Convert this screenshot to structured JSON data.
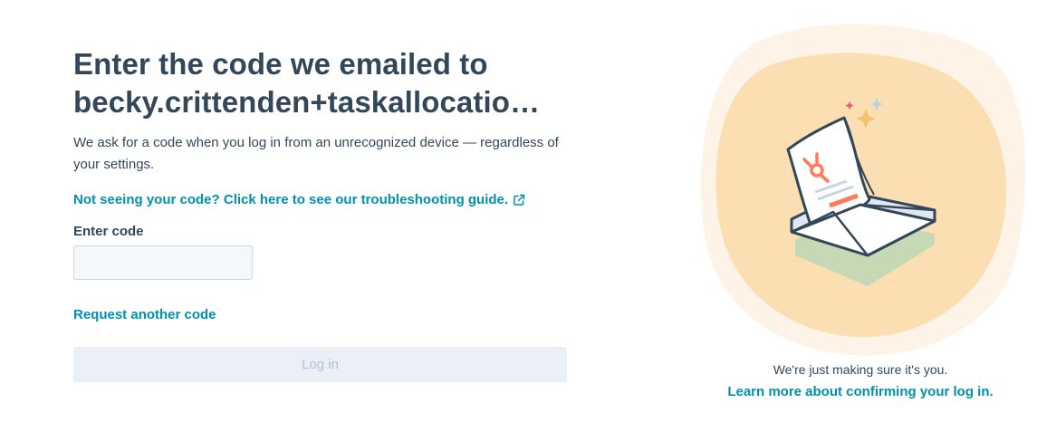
{
  "heading": {
    "line1": "Enter the code we emailed to",
    "line2": "becky.crittenden+taskallocatio…"
  },
  "description": "We ask for a code when you log in from an unrecognized device — regardless of your settings.",
  "troubleshooting_link": {
    "label": "Not seeing your code? Click here to see our troubleshooting guide.",
    "icon": "external-link-icon"
  },
  "code_field": {
    "label": "Enter code",
    "value": "",
    "placeholder": ""
  },
  "request_link": {
    "label": "Request another code"
  },
  "login_button": {
    "label": "Log in",
    "disabled": true
  },
  "side_panel": {
    "caption": "We're just making sure it's you.",
    "learn_more_label": "Learn more about confirming your log in.",
    "illustration": "envelope-with-letter-illustration"
  },
  "colors": {
    "text": "#33475b",
    "link": "#0091ae",
    "button_disabled_bg": "#eaf0f6",
    "button_disabled_text": "#b0c1d4",
    "blob_outer": "#fdf3e7",
    "blob_inner": "#fbdfb3",
    "brand_orange": "#ff7a59"
  }
}
